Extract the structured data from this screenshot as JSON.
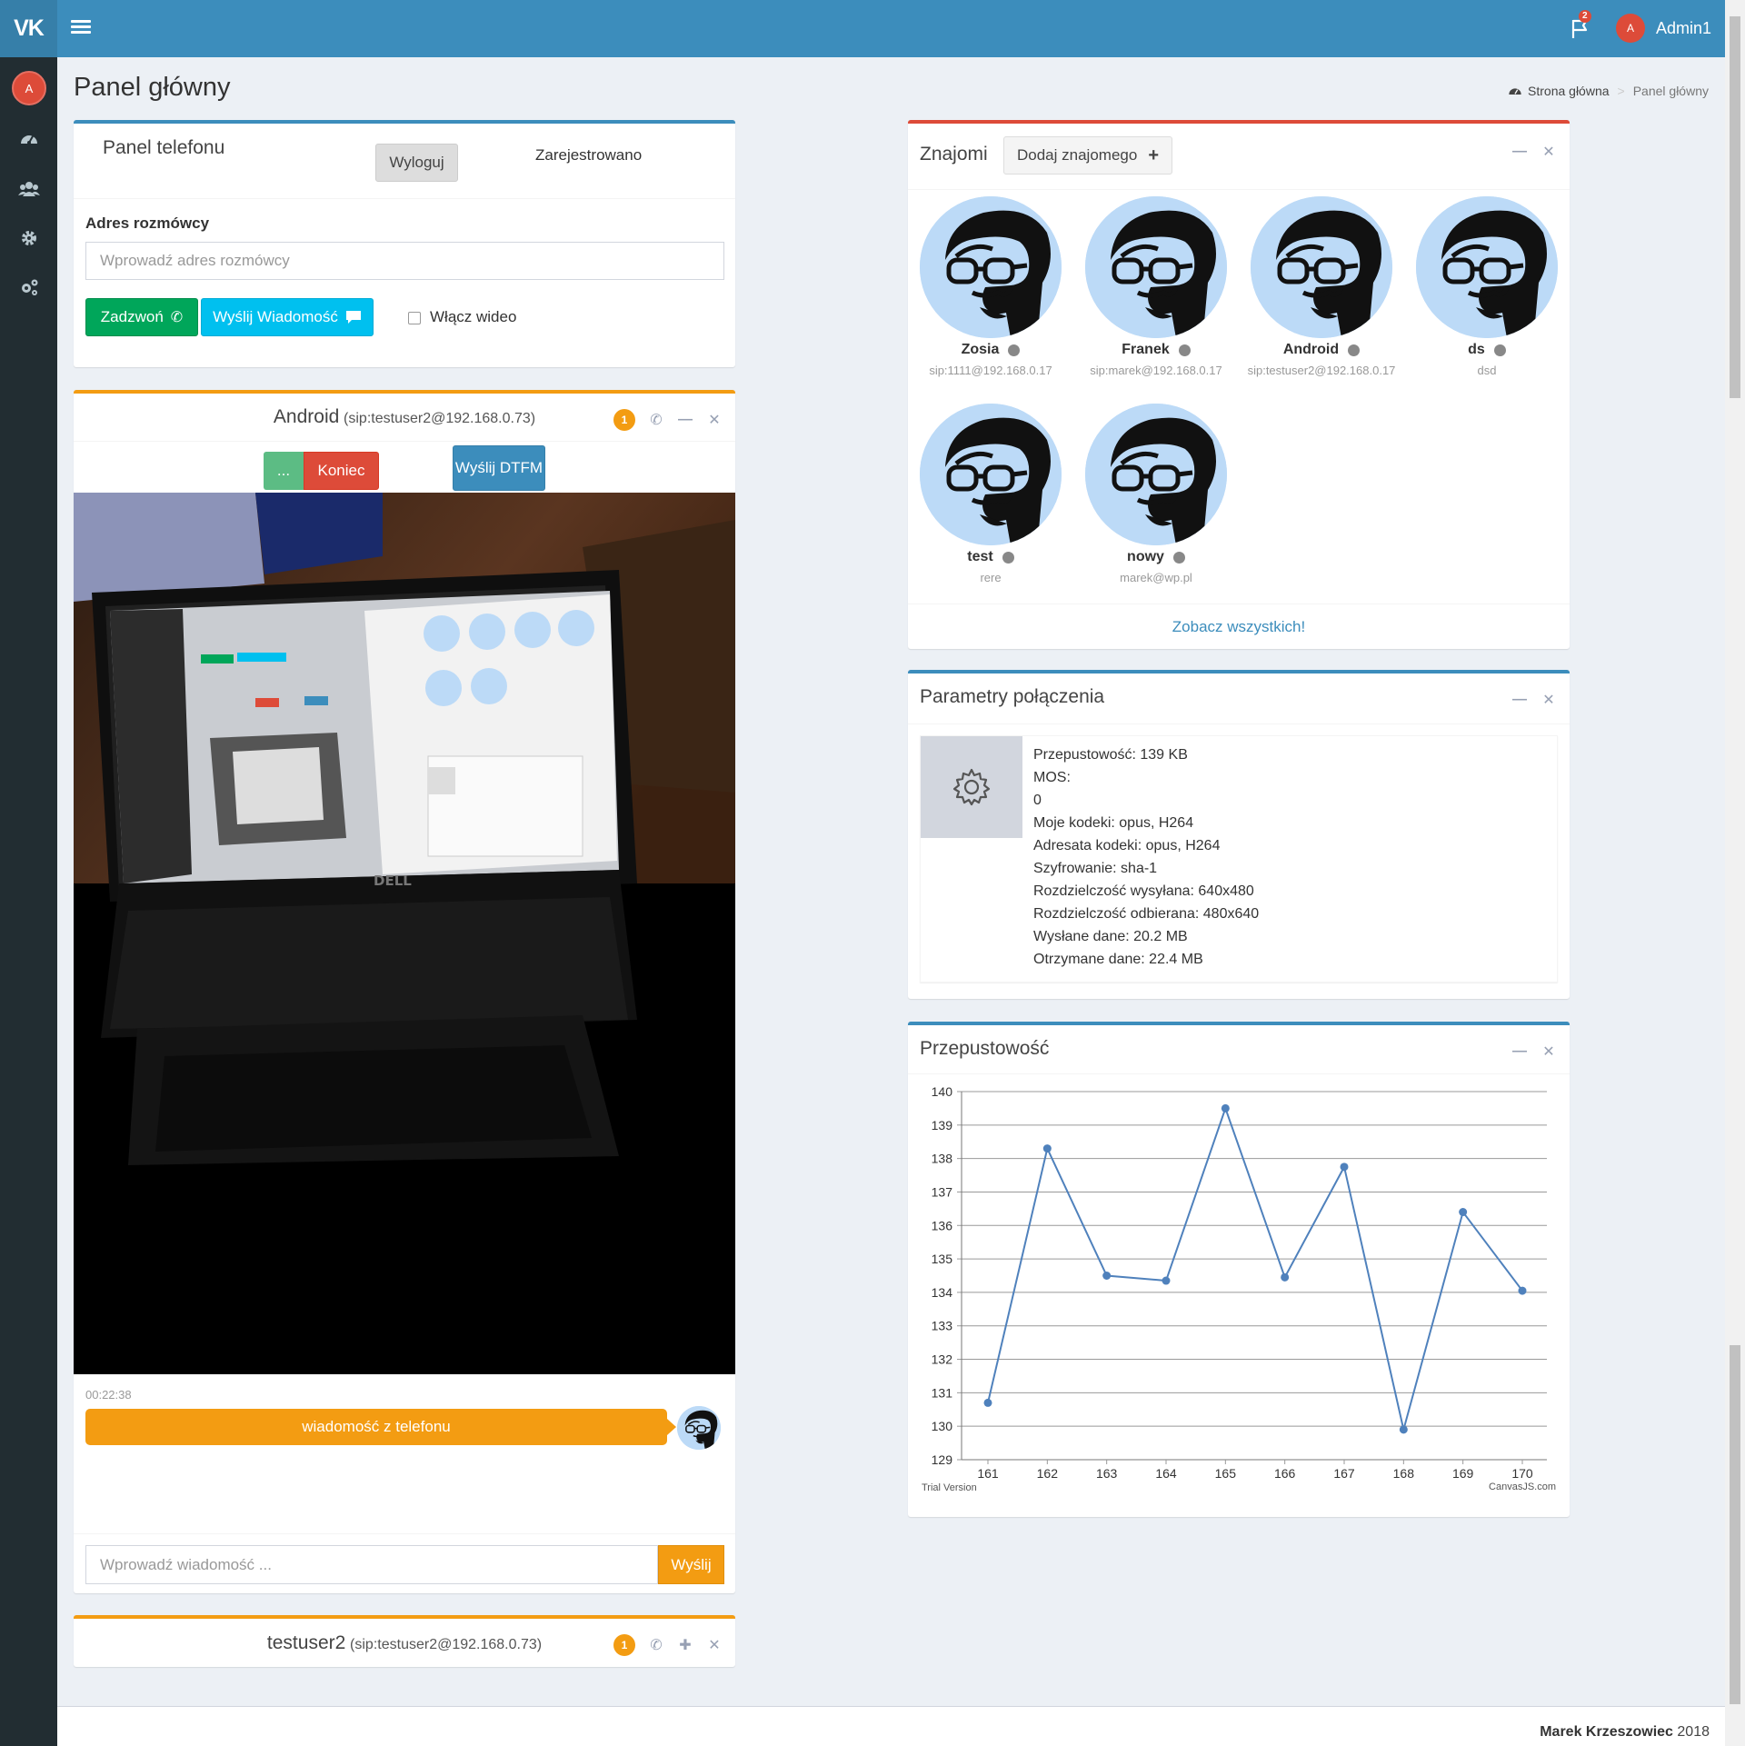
{
  "app": {
    "logo": "VK",
    "user": "Admin1",
    "user_initial": "A",
    "notifications": "2"
  },
  "sidebar": {
    "items": [
      "dashboard-icon",
      "users-icon",
      "gear-icon",
      "gears-icon"
    ]
  },
  "page": {
    "title": "Panel główny",
    "breadcrumb": [
      "Strona główna",
      "Panel główny"
    ]
  },
  "phone_panel": {
    "title": "Panel telefonu",
    "logout_label": "Wyloguj",
    "status": "Zarejestrowano",
    "address_label": "Adres rozmówcy",
    "address_placeholder": "Wprowadź adres rozmówcy",
    "call_label": "Zadzwoń",
    "message_label": "Wyślij Wiadomość",
    "video_label": "Włącz wideo"
  },
  "call": {
    "name": "Android",
    "sip": "(sip:testuser2@192.168.0.73)",
    "badge": "1",
    "dots_label": "...",
    "end_label": "Koniec",
    "dtmf_label": "Wyślij DTFM",
    "time": "00:22:38",
    "message": "wiadomość z telefonu",
    "input_placeholder": "Wprowadź wiadomość ...",
    "send_label": "Wyślij"
  },
  "collapsed_call": {
    "name": "testuser2",
    "sip": "(sip:testuser2@192.168.0.73)",
    "badge": "1"
  },
  "friends": {
    "title": "Znajomi",
    "add_label": "Dodaj znajomego",
    "view_all": "Zobacz wszystkich!",
    "items": [
      {
        "name": "Zosia",
        "sip": "sip:1111@192.168.0.17"
      },
      {
        "name": "Franek",
        "sip": "sip:marek@192.168.0.17"
      },
      {
        "name": "Android",
        "sip": "sip:testuser2@192.168.0.17"
      },
      {
        "name": "ds",
        "sip": "dsd"
      },
      {
        "name": "test",
        "sip": "rere"
      },
      {
        "name": "nowy",
        "sip": "marek@wp.pl"
      }
    ]
  },
  "params": {
    "title": "Parametry połączenia",
    "lines": [
      "Przepustowość: 139 KB",
      "MOS:",
      "0",
      "Moje kodeki: opus, H264",
      "Adresata kodeki: opus, H264",
      "Szyfrowanie: sha-1",
      "Rozdzielczość wysyłana: 640x480",
      "Rozdzielczość odbierana: 480x640",
      "Wysłane dane: 20.2 MB",
      "Otrzymane dane: 22.4 MB"
    ]
  },
  "chart_data": {
    "type": "line",
    "title": "Przepustowość",
    "x": [
      161,
      162,
      163,
      164,
      165,
      166,
      167,
      168,
      169,
      170
    ],
    "values": [
      130.7,
      138.3,
      134.5,
      134.35,
      139.5,
      134.45,
      137.75,
      129.9,
      136.4,
      134.05
    ],
    "ylim": [
      129,
      140
    ],
    "yticks": [
      129,
      130,
      131,
      132,
      133,
      134,
      135,
      136,
      137,
      138,
      139,
      140
    ],
    "color": "#4f81bc",
    "watermark_left": "Trial Version",
    "watermark_right": "CanvasJS.com"
  },
  "footer": {
    "author": "Marek Krzeszowiec",
    "year": "2018"
  }
}
